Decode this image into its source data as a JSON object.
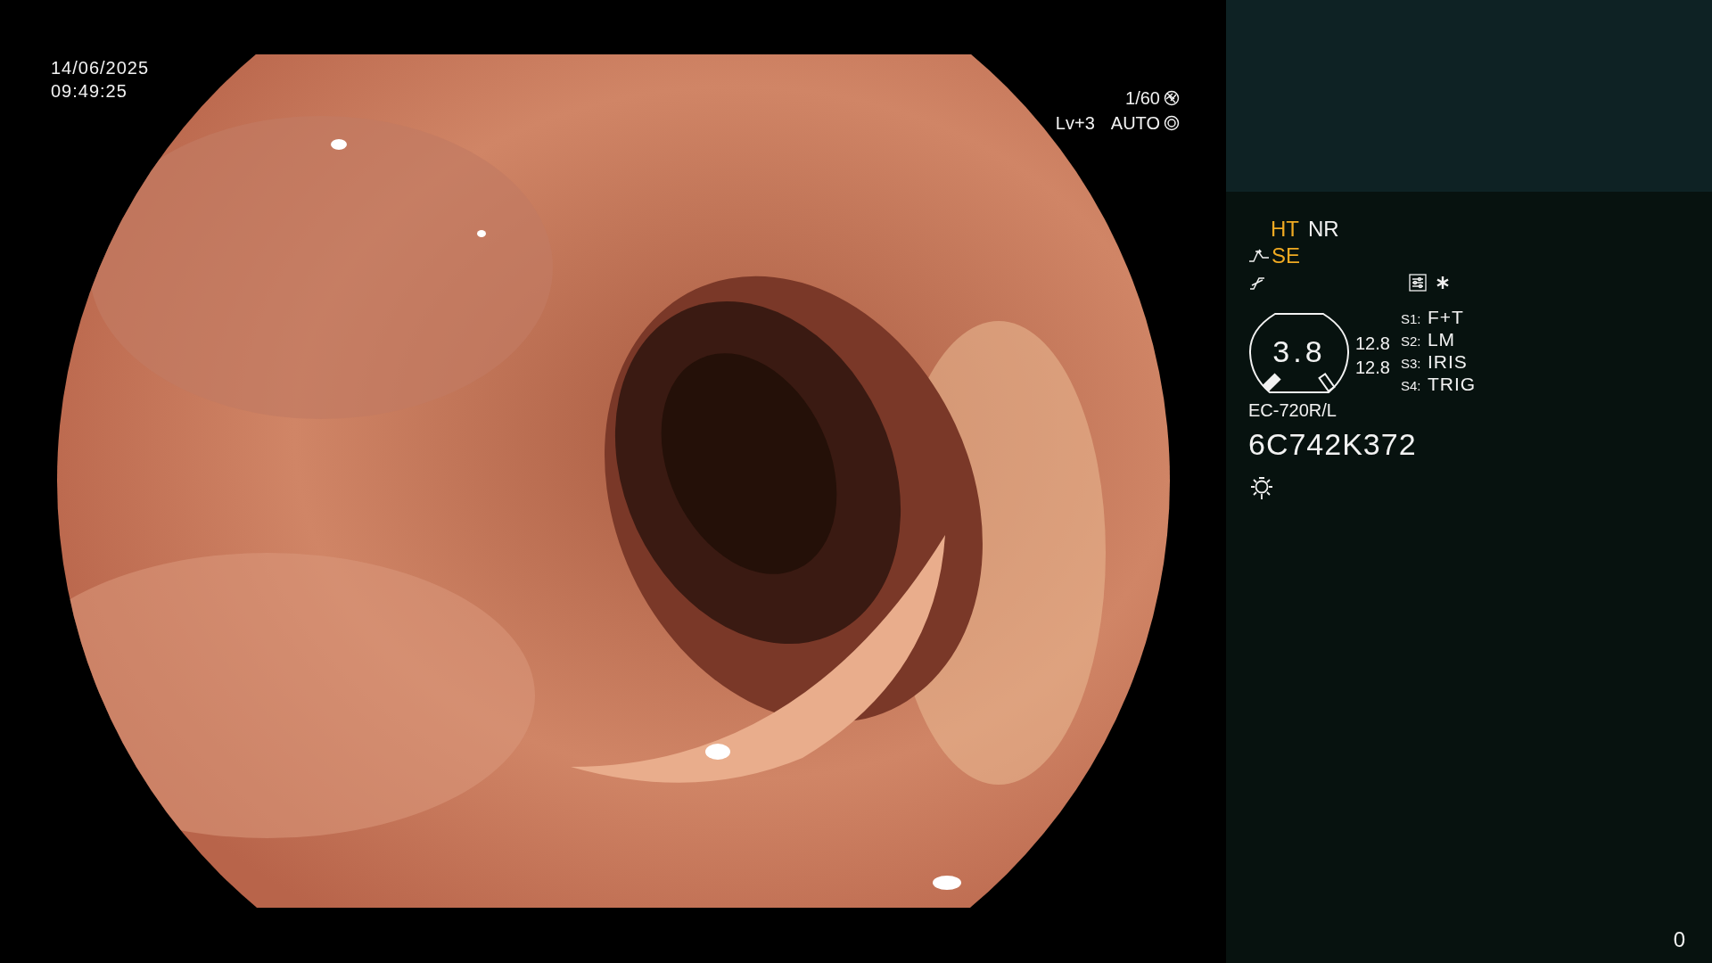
{
  "timestamp": {
    "date": "14/06/2025",
    "time": "09:49:25"
  },
  "exposure": {
    "shutter": "1/60",
    "level": "Lv+3",
    "mode": "AUTO"
  },
  "panel": {
    "modes": [
      {
        "label": "HT",
        "active": true
      },
      {
        "label": "NR",
        "active": false
      }
    ],
    "enhance": {
      "label": "SE",
      "active": true
    },
    "gauge": {
      "value": "3.8",
      "readings": [
        "12.8",
        "12.8"
      ]
    },
    "switches": [
      {
        "key": "S1:",
        "value": "F+T"
      },
      {
        "key": "S2:",
        "value": "LM"
      },
      {
        "key": "S3:",
        "value": "IRIS"
      },
      {
        "key": "S4:",
        "value": "TRIG"
      }
    ],
    "model": "EC-720R/L",
    "serial": "6C742K372"
  },
  "counter": "0"
}
